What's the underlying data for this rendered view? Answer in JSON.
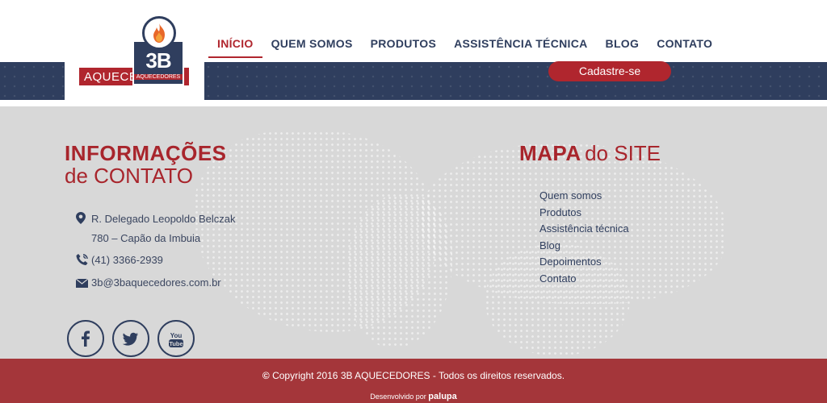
{
  "header": {
    "logo": {
      "text_3b": "3B",
      "text_aquec": "AQUECEDORES",
      "text_sub": "AQUECEDORES"
    },
    "nav": [
      {
        "label": "INÍCIO",
        "active": true
      },
      {
        "label": "QUEM SOMOS",
        "active": false
      },
      {
        "label": "PRODUTOS",
        "active": false
      },
      {
        "label": "ASSISTÊNCIA TÉCNICA",
        "active": false
      },
      {
        "label": "BLOG",
        "active": false
      },
      {
        "label": "CONTATO",
        "active": false
      }
    ],
    "cta_label": "Cadastre-se"
  },
  "contact": {
    "title_strong": "INFORMAÇÕES",
    "title_light": "de CONTATO",
    "address_line1": "R. Delegado Leopoldo Belczak",
    "address_line2": "780 – Capão da Imbuia",
    "phone": "(41) 3366-2939",
    "email": "3b@3baquecedores.com.br",
    "social": [
      "facebook-icon",
      "twitter-icon",
      "youtube-icon"
    ]
  },
  "sitemap": {
    "title_strong": "MAPA",
    "title_light": "do SITE",
    "links": [
      "Quem somos",
      "Produtos",
      "Assistência técnica",
      "Blog",
      "Depoimentos",
      "Contato"
    ]
  },
  "footer": {
    "copyright_symbol": "©",
    "copyright": "Copyright 2016",
    "company": "3B AQUECEDORES",
    "rights": "- Todos os direitos reservados.",
    "dev_label": "Desenvolvido por",
    "dev_brand": "palupa"
  },
  "colors": {
    "navy": "#2f3e5e",
    "red": "#b0262e",
    "footer": "#a4363a",
    "bg": "#d8d8d8"
  }
}
